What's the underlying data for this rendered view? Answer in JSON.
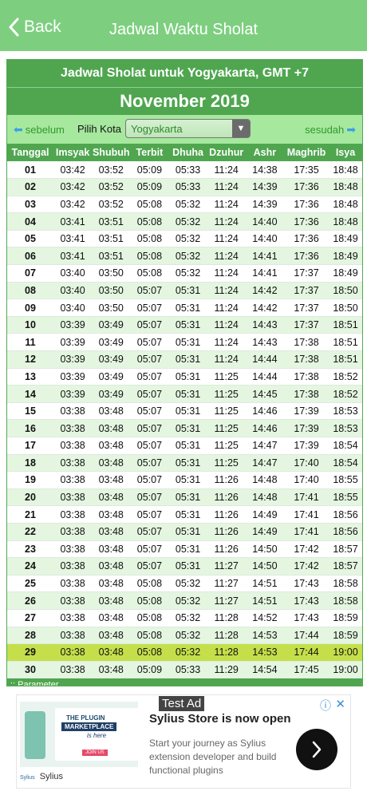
{
  "nav": {
    "back_label": "Back",
    "title": "Jadwal Waktu Sholat"
  },
  "schedule": {
    "heading": "Jadwal Sholat untuk Yogyakarta, GMT +7",
    "month": "November 2019",
    "prev_label": "sebelum",
    "next_label": "sesudah",
    "city_label": "Pilih Kota",
    "city_value": "Yogyakarta",
    "columns": [
      "Tanggal",
      "Imsyak",
      "Shubuh",
      "Terbit",
      "Dhuha",
      "Dzuhur",
      "Ashr",
      "Maghrib",
      "Isya"
    ],
    "rows": [
      [
        "01",
        "03:42",
        "03:52",
        "05:09",
        "05:33",
        "11:24",
        "14:38",
        "17:35",
        "18:48"
      ],
      [
        "02",
        "03:42",
        "03:52",
        "05:09",
        "05:33",
        "11:24",
        "14:39",
        "17:36",
        "18:48"
      ],
      [
        "03",
        "03:42",
        "03:52",
        "05:08",
        "05:32",
        "11:24",
        "14:39",
        "17:36",
        "18:48"
      ],
      [
        "04",
        "03:41",
        "03:51",
        "05:08",
        "05:32",
        "11:24",
        "14:40",
        "17:36",
        "18:48"
      ],
      [
        "05",
        "03:41",
        "03:51",
        "05:08",
        "05:32",
        "11:24",
        "14:40",
        "17:36",
        "18:49"
      ],
      [
        "06",
        "03:41",
        "03:51",
        "05:08",
        "05:32",
        "11:24",
        "14:41",
        "17:36",
        "18:49"
      ],
      [
        "07",
        "03:40",
        "03:50",
        "05:08",
        "05:32",
        "11:24",
        "14:41",
        "17:37",
        "18:49"
      ],
      [
        "08",
        "03:40",
        "03:50",
        "05:07",
        "05:31",
        "11:24",
        "14:42",
        "17:37",
        "18:50"
      ],
      [
        "09",
        "03:40",
        "03:50",
        "05:07",
        "05:31",
        "11:24",
        "14:42",
        "17:37",
        "18:50"
      ],
      [
        "10",
        "03:39",
        "03:49",
        "05:07",
        "05:31",
        "11:24",
        "14:43",
        "17:37",
        "18:51"
      ],
      [
        "11",
        "03:39",
        "03:49",
        "05:07",
        "05:31",
        "11:24",
        "14:43",
        "17:38",
        "18:51"
      ],
      [
        "12",
        "03:39",
        "03:49",
        "05:07",
        "05:31",
        "11:24",
        "14:44",
        "17:38",
        "18:51"
      ],
      [
        "13",
        "03:39",
        "03:49",
        "05:07",
        "05:31",
        "11:25",
        "14:44",
        "17:38",
        "18:52"
      ],
      [
        "14",
        "03:39",
        "03:49",
        "05:07",
        "05:31",
        "11:25",
        "14:45",
        "17:38",
        "18:52"
      ],
      [
        "15",
        "03:38",
        "03:48",
        "05:07",
        "05:31",
        "11:25",
        "14:46",
        "17:39",
        "18:53"
      ],
      [
        "16",
        "03:38",
        "03:48",
        "05:07",
        "05:31",
        "11:25",
        "14:46",
        "17:39",
        "18:53"
      ],
      [
        "17",
        "03:38",
        "03:48",
        "05:07",
        "05:31",
        "11:25",
        "14:47",
        "17:39",
        "18:54"
      ],
      [
        "18",
        "03:38",
        "03:48",
        "05:07",
        "05:31",
        "11:25",
        "14:47",
        "17:40",
        "18:54"
      ],
      [
        "19",
        "03:38",
        "03:48",
        "05:07",
        "05:31",
        "11:26",
        "14:48",
        "17:40",
        "18:55"
      ],
      [
        "20",
        "03:38",
        "03:48",
        "05:07",
        "05:31",
        "11:26",
        "14:48",
        "17:41",
        "18:55"
      ],
      [
        "21",
        "03:38",
        "03:48",
        "05:07",
        "05:31",
        "11:26",
        "14:49",
        "17:41",
        "18:56"
      ],
      [
        "22",
        "03:38",
        "03:48",
        "05:07",
        "05:31",
        "11:26",
        "14:49",
        "17:41",
        "18:56"
      ],
      [
        "23",
        "03:38",
        "03:48",
        "05:07",
        "05:31",
        "11:26",
        "14:50",
        "17:42",
        "18:57"
      ],
      [
        "24",
        "03:38",
        "03:48",
        "05:07",
        "05:31",
        "11:27",
        "14:50",
        "17:42",
        "18:57"
      ],
      [
        "25",
        "03:38",
        "03:48",
        "05:08",
        "05:32",
        "11:27",
        "14:51",
        "17:43",
        "18:58"
      ],
      [
        "26",
        "03:38",
        "03:48",
        "05:08",
        "05:32",
        "11:27",
        "14:51",
        "17:43",
        "18:58"
      ],
      [
        "27",
        "03:38",
        "03:48",
        "05:08",
        "05:32",
        "11:28",
        "14:52",
        "17:43",
        "18:59"
      ],
      [
        "28",
        "03:38",
        "03:48",
        "05:08",
        "05:32",
        "11:28",
        "14:53",
        "17:44",
        "18:59"
      ],
      [
        "29",
        "03:38",
        "03:48",
        "05:08",
        "05:32",
        "11:28",
        "14:53",
        "17:44",
        "19:00"
      ],
      [
        "30",
        "03:38",
        "03:48",
        "05:09",
        "05:33",
        "11:29",
        "14:54",
        "17:45",
        "19:00"
      ]
    ],
    "highlight_date": "29",
    "parameter_label": ":: Parameter"
  },
  "ad": {
    "badge": "Test Ad",
    "title": "Sylius Store is now open",
    "description": "Start your journey as Sylius extension developer and build functional plugins",
    "brand": "Sylius",
    "image_line1": "THE PLUGIN",
    "image_line2": "MARKETPLACE",
    "image_line3": "is here",
    "image_cta": "JOIN US",
    "logo_small": "Sylius"
  },
  "colors": {
    "nav": "#7dcf7f",
    "header": "#4fa64f",
    "row_alt": "#e4f6e0",
    "today": "#c4df4a"
  }
}
